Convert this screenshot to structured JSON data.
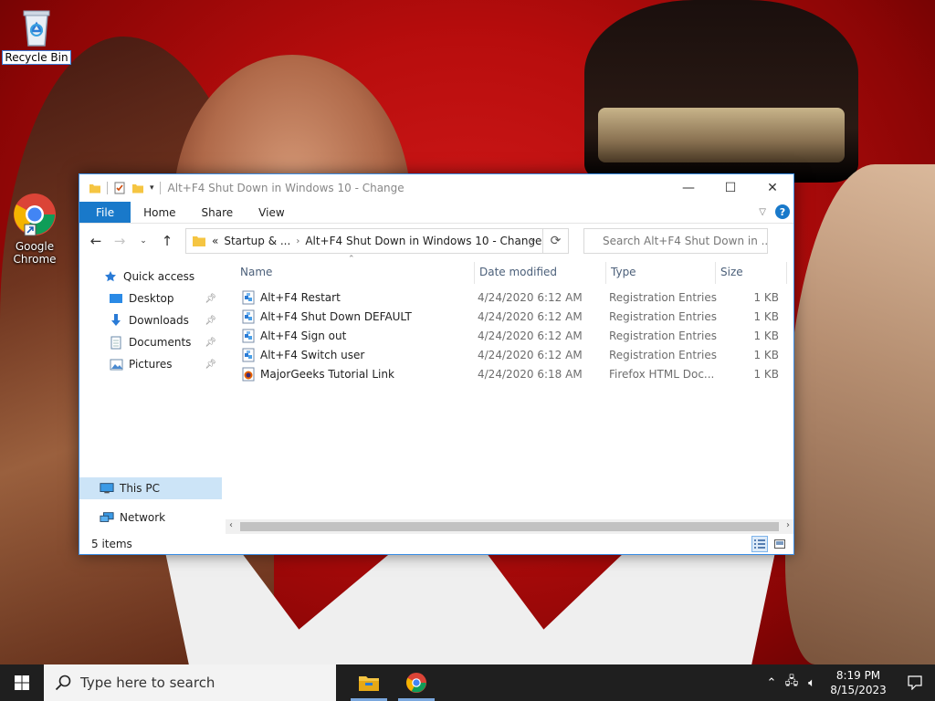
{
  "desktop": {
    "icons": [
      {
        "label": "Recycle Bin",
        "icon": "recycle-bin-icon"
      },
      {
        "label": "Google Chrome",
        "icon": "chrome-icon"
      }
    ]
  },
  "window": {
    "title": "Alt+F4 Shut Down in Windows 10 - Change",
    "ribbon_tabs": [
      "File",
      "Home",
      "Share",
      "View"
    ],
    "address": {
      "overflow": "«",
      "segments": [
        "Startup & ...",
        "Alt+F4 Shut Down in Windows 10 - Change"
      ]
    },
    "search_placeholder": "Search Alt+F4 Shut Down in ...",
    "nav": {
      "quick_access": "Quick access",
      "desktop": "Desktop",
      "downloads": "Downloads",
      "documents": "Documents",
      "pictures": "Pictures",
      "this_pc": "This PC",
      "network": "Network"
    },
    "columns": {
      "name": "Name",
      "date": "Date modified",
      "type": "Type",
      "size": "Size"
    },
    "files": [
      {
        "name": "Alt+F4 Restart",
        "date": "4/24/2020 6:12 AM",
        "type": "Registration Entries",
        "size": "1 KB",
        "icon": "registry-file-icon"
      },
      {
        "name": "Alt+F4 Shut Down DEFAULT",
        "date": "4/24/2020 6:12 AM",
        "type": "Registration Entries",
        "size": "1 KB",
        "icon": "registry-file-icon"
      },
      {
        "name": "Alt+F4 Sign out",
        "date": "4/24/2020 6:12 AM",
        "type": "Registration Entries",
        "size": "1 KB",
        "icon": "registry-file-icon"
      },
      {
        "name": "Alt+F4 Switch user",
        "date": "4/24/2020 6:12 AM",
        "type": "Registration Entries",
        "size": "1 KB",
        "icon": "registry-file-icon"
      },
      {
        "name": "MajorGeeks Tutorial Link",
        "date": "4/24/2020 6:18 AM",
        "type": "Firefox HTML Doc...",
        "size": "1 KB",
        "icon": "firefox-html-icon"
      }
    ],
    "status": "5 items"
  },
  "taskbar": {
    "search_placeholder": "Type here to search",
    "time": "8:19 PM",
    "date": "8/15/2023"
  },
  "colors": {
    "accent": "#1979ca",
    "selection": "#cce4f7",
    "taskbar": "#1f1f1f"
  }
}
